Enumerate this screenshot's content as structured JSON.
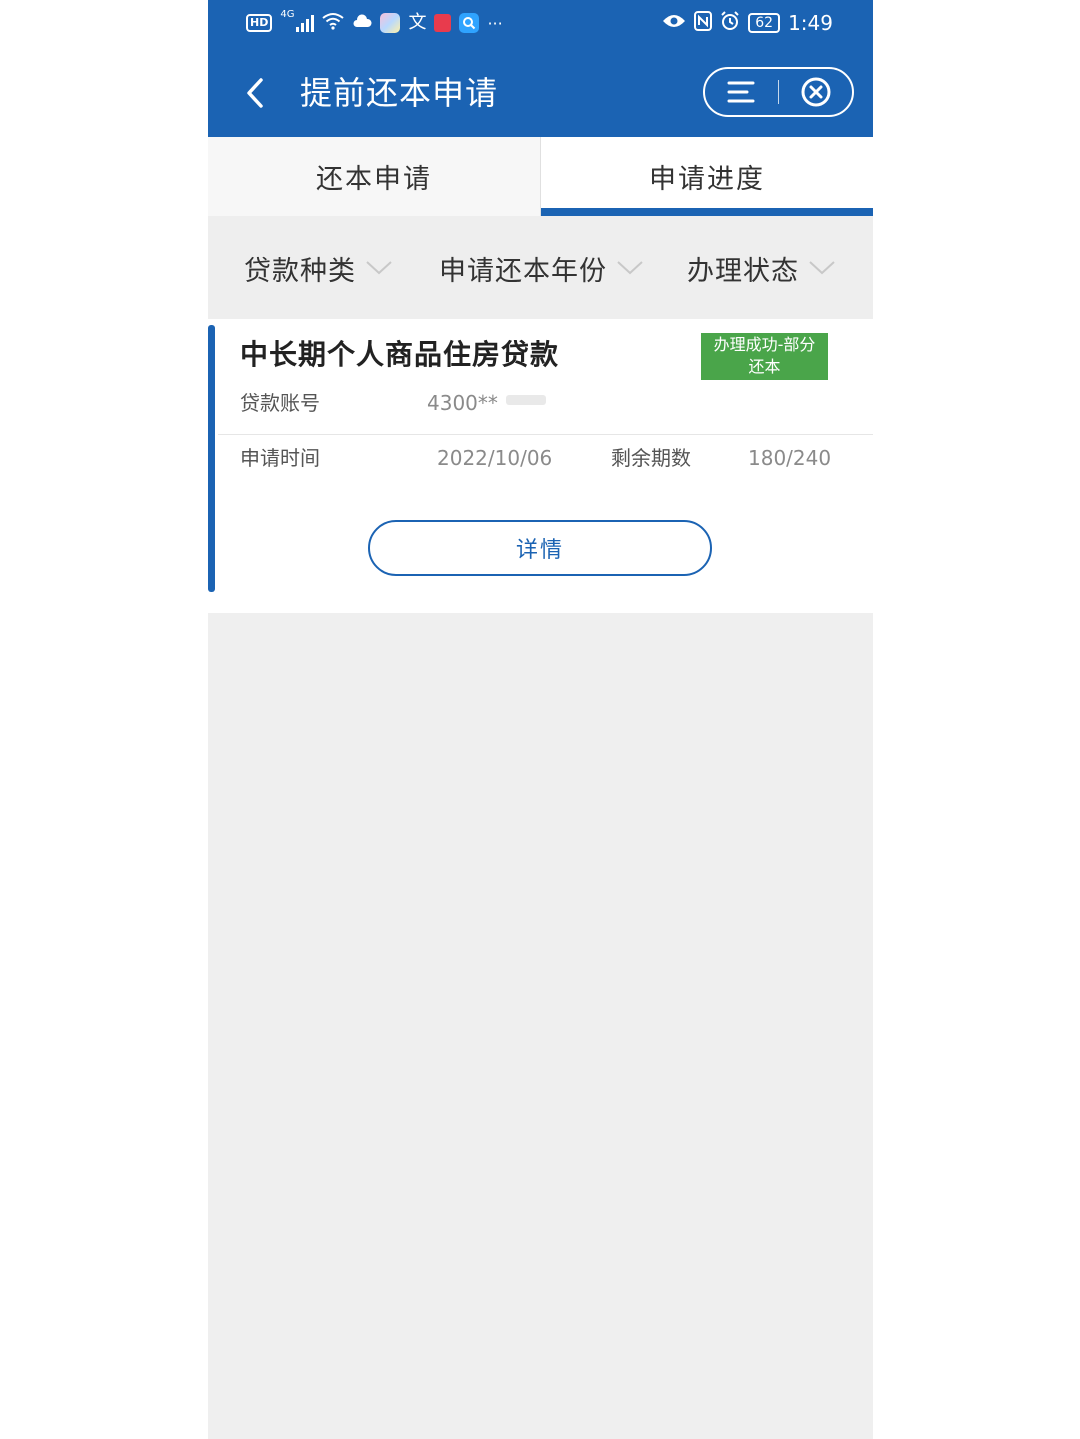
{
  "status_bar": {
    "hd": "HD",
    "network": "4G",
    "battery": "62",
    "time": "1:49",
    "more": "···",
    "icons": [
      "hd-icon",
      "signal-icon",
      "wifi-icon",
      "cloud-icon",
      "app-icon",
      "translate-icon",
      "book-icon",
      "search-app-icon",
      "eye-icon",
      "nfc-icon",
      "alarm-icon",
      "battery-icon"
    ]
  },
  "header": {
    "title": "提前还本申请",
    "back_icon": "chevron-left-icon",
    "menu_icon": "menu-icon",
    "close_icon": "close-circle-icon"
  },
  "tabs": [
    {
      "label": "还本申请",
      "active": false
    },
    {
      "label": "申请进度",
      "active": true
    }
  ],
  "filters": [
    {
      "label": "贷款种类"
    },
    {
      "label": "申请还本年份"
    },
    {
      "label": "办理状态"
    }
  ],
  "application": {
    "loan_type": "中长期个人商品住房贷款",
    "status_badge_line1": "办理成功-部分",
    "status_badge_line2": "还本",
    "account_label": "贷款账号",
    "account_value": "4300**",
    "apply_time_label": "申请时间",
    "apply_time_value": "2022/10/06",
    "remaining_label": "剩余期数",
    "remaining_value": "180/240",
    "details_button": "详情"
  },
  "colors": {
    "primary": "#1b63b3",
    "success": "#4aa54a",
    "background": "#efefef"
  }
}
